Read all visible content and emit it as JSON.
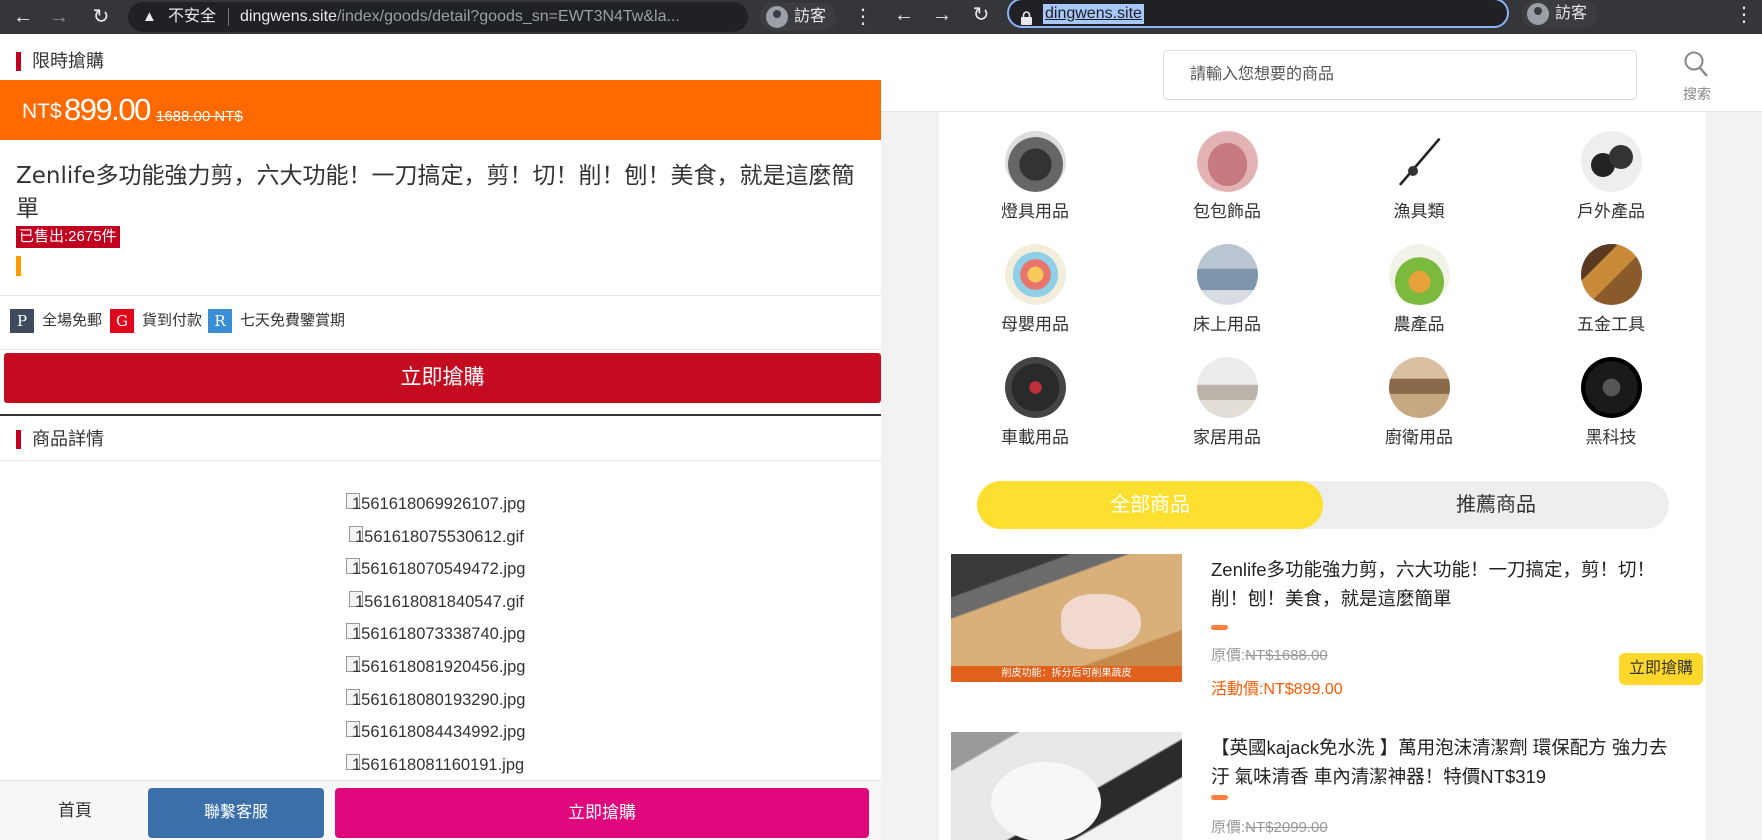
{
  "left_browser": {
    "insecure_label": "不安全",
    "url_host": "dingwens.site",
    "url_path": "/index/goods/detail?goods_sn=EWT3N4Tw&la...",
    "profile_label": "訪客"
  },
  "right_browser": {
    "url": "dingwens.site",
    "profile_label": "訪客"
  },
  "detail": {
    "flash_title": "限時搶購",
    "price_unit": "NT$",
    "price": "899.00",
    "old_price": "1688.00 NT$",
    "product_title": "Zenlife多功能強力剪，六大功能！一刀搞定，剪！切！削！刨！美食，就是這麼簡單",
    "sold": "已售出:2675件",
    "features": [
      {
        "badge": "P",
        "label": "全場免郵",
        "color": "#3d4b5c"
      },
      {
        "badge": "G",
        "label": "貨到付款",
        "color": "#e0071c"
      },
      {
        "badge": "R",
        "label": "七天免費鑒賞期",
        "color": "#3a8ed4"
      }
    ],
    "buy_now": "立即搶購",
    "details_title": "商品詳情",
    "images": [
      "1561618069926107.jpg",
      "1561618075530612.gif",
      "1561618070549472.jpg",
      "1561618081840547.gif",
      "1561618073338740.jpg",
      "1561618081920456.jpg",
      "1561618080193290.jpg",
      "1561618084434992.jpg",
      "1561618081160191.jpg"
    ],
    "bottom": {
      "home": "首頁",
      "service": "聯繫客服",
      "buy": "立即搶購"
    }
  },
  "shop": {
    "search_placeholder": "請輸入您想要的商品",
    "search_label": "搜索",
    "categories": [
      {
        "label": "燈具用品",
        "icon": "headlamp-photo"
      },
      {
        "label": "包包飾品",
        "icon": "pink-bag-photo"
      },
      {
        "label": "漁具類",
        "icon": "fishing-rod-photo"
      },
      {
        "label": "戶外產品",
        "icon": "binoculars-photo"
      },
      {
        "label": "母嬰用品",
        "icon": "baby-toy-photo"
      },
      {
        "label": "床上用品",
        "icon": "bedding-photo"
      },
      {
        "label": "農產品",
        "icon": "vegetables-photo"
      },
      {
        "label": "五金工具",
        "icon": "tools-photo"
      },
      {
        "label": "車載用品",
        "icon": "car-interior-photo"
      },
      {
        "label": "家居用品",
        "icon": "living-room-photo"
      },
      {
        "label": "廚衛用品",
        "icon": "kitchen-photo"
      },
      {
        "label": "黑科技",
        "icon": "tech-sphere-photo"
      }
    ],
    "tabs": {
      "all": "全部商品",
      "recommended": "推薦商品"
    },
    "products": [
      {
        "title": "Zenlife多功能強力剪，六大功能！一刀搞定，剪！切！削！刨！美食，就是這麼簡單",
        "orig_label": "原價:",
        "orig_price": "NT$1688.00",
        "act_label": "活動價:",
        "act_price": "NT$899.00",
        "buy": "立即搶購",
        "img_caption": "削皮功能：拆分后可削果蔬皮"
      },
      {
        "title": "【英國kajack免水洗 】萬用泡沫清潔劑 環保配方 強力去汙 氣味清香 車內清潔神器！特價NT$319",
        "orig_label": "原價:",
        "orig_price": "NT$2099.00"
      }
    ]
  }
}
